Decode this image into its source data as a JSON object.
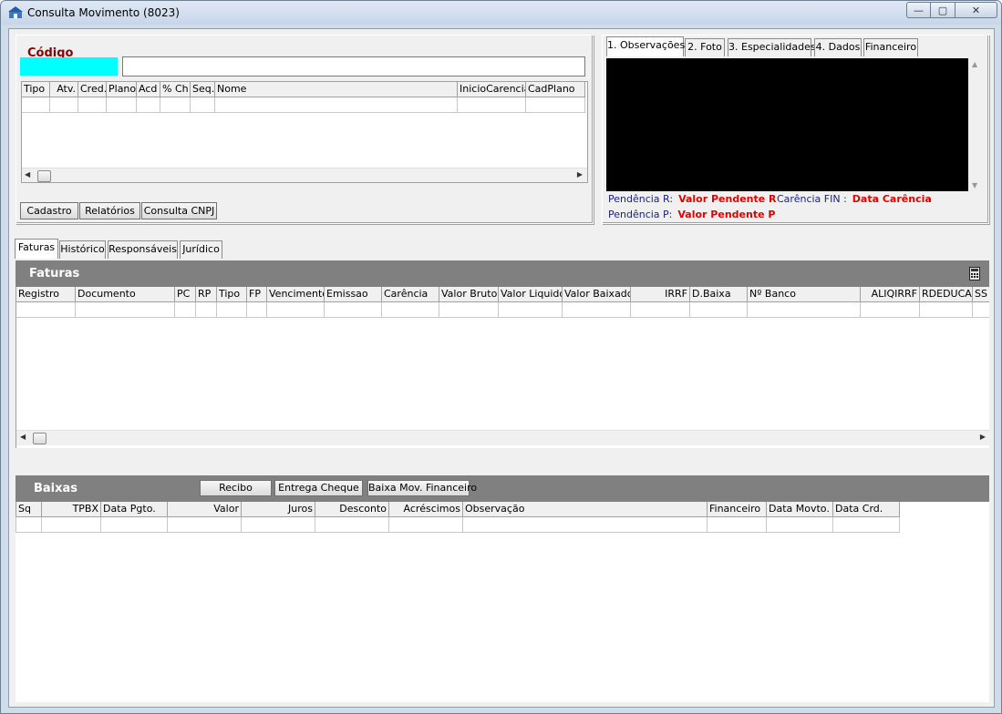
{
  "window": {
    "title": "Consulta Movimento (8023)",
    "controls": {
      "minimize": "—",
      "maximize": "▢",
      "close": "✕"
    }
  },
  "top_left": {
    "codigo_label": "Código",
    "codigo_value": "",
    "nome_value": "",
    "grid_columns": [
      "Tipo",
      "Atv.",
      "Cred.",
      "Plano",
      "Acd",
      "% Ch",
      "Seq.",
      "Nome",
      "InicioCarencia",
      "CadPlano"
    ],
    "buttons": {
      "cadastro": "Cadastro",
      "relatorios": "Relatórios",
      "consulta_cnpj": "Consulta CNPJ"
    }
  },
  "top_right": {
    "tabs": [
      "1. Observações",
      "2. Foto",
      "3. Especialidades",
      "4. Dados",
      "Financeiro"
    ],
    "pendencia_r_label": "Pendência R:",
    "pendencia_r_value": "Valor Pendente R",
    "carencia_label": "Carência FIN :",
    "carencia_value": "Data Carência",
    "pendencia_p_label": "Pendência P:",
    "pendencia_p_value": "Valor Pendente P"
  },
  "main_tabs": [
    "Faturas",
    "Histórico",
    "Responsáveis",
    "Jurídico"
  ],
  "faturas": {
    "title": "Faturas",
    "columns": [
      "Registro",
      "Documento",
      "PC",
      "RP",
      "Tipo",
      "FP",
      "Vencimento",
      "Emissao",
      "Carência",
      "Valor Bruto",
      "Valor Liquido",
      "Valor Baixado",
      "IRRF",
      "D.Baixa",
      "Nº Banco",
      "ALIQIRRF",
      "RDEDUCAO",
      "SS"
    ]
  },
  "baixas": {
    "title": "Baixas",
    "buttons": {
      "recibo": "Recibo",
      "entrega_cheque": "Entrega Cheque",
      "baixa_mov": "Baixa Mov. Financeiro"
    },
    "columns": [
      "Sq",
      "TPBX",
      "Data Pgto.",
      "Valor",
      "Juros",
      "Desconto",
      "Acréscimos",
      "Observação",
      "Financeiro",
      "Data Movto.",
      "Data Crd."
    ]
  },
  "colors": {
    "codigo_label": "#8b0000",
    "codigo_input": "#00ffff",
    "section_bar": "#808080",
    "pendencia_value": "#e00000",
    "pendencia_label": "#1a237e"
  }
}
